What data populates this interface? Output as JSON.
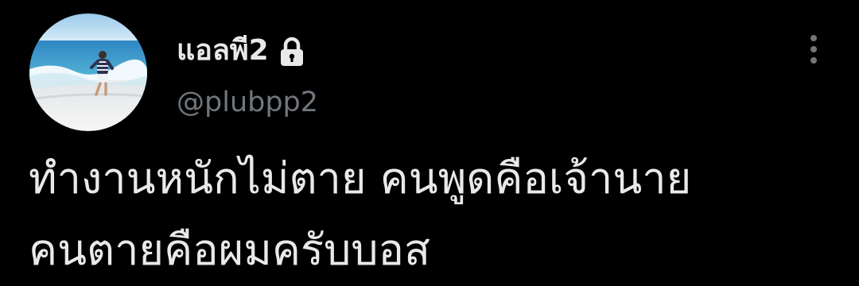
{
  "user": {
    "display_name": "แอลพี2",
    "handle": "@plubpp2",
    "avatar_icon": "beach-photo-avatar",
    "protected_icon": "lock-icon"
  },
  "menu": {
    "icon": "more-vertical-icon"
  },
  "tweet": {
    "lines": [
      "ทำงานหนักไม่ตาย คนพูดคือเจ้านาย",
      "คนตายคือผมครับบอส"
    ]
  },
  "colors": {
    "background": "#000000",
    "primary_text": "#e7e9ea",
    "secondary_text": "#71767b"
  }
}
